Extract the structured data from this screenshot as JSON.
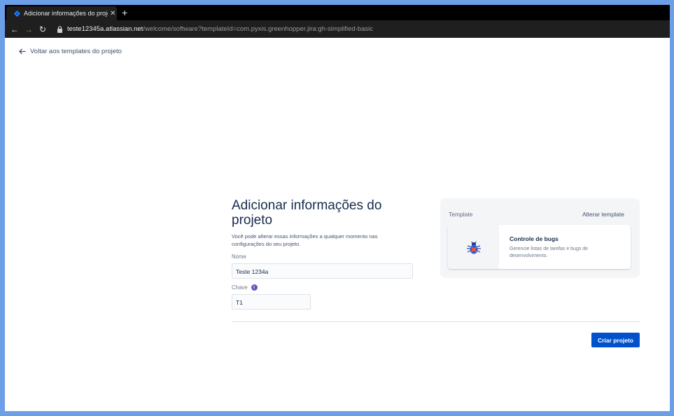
{
  "browser": {
    "tab_title": "Adicionar informações do projeto",
    "tab_close": "✕",
    "new_tab": "+",
    "url_host": "teste12345a.atlassian.net",
    "url_path": "/welcome/software?templateId=com.pyxis.greenhopper.jira:gh-simplified-basic",
    "nav": {
      "back": "←",
      "forward": "→",
      "reload": "↻"
    },
    "favicon": "jira-icon"
  },
  "back_link": {
    "label": "Voltar aos templates do projeto",
    "icon": "arrow-left-icon"
  },
  "form": {
    "title": "Adicionar informações do projeto",
    "subtitle": "Você pode alterar essas informações a qualquer momento nas configurações do seu projeto.",
    "name_label": "Nome",
    "name_value": "Teste 1234a",
    "key_label": "Chave",
    "key_info": "i",
    "key_value": "T1"
  },
  "template_card": {
    "label": "Template",
    "change_label": "Alterar template",
    "template_name": "Controle de bugs",
    "template_desc": "Gerencie listas de tarefas e bugs de desenvolvimento.",
    "icon": "bug-icon"
  },
  "actions": {
    "create_label": "Criar projeto"
  },
  "colors": {
    "primary": "#0052cc",
    "text": "#172b4d",
    "accent_border": "#6d9ee8"
  }
}
